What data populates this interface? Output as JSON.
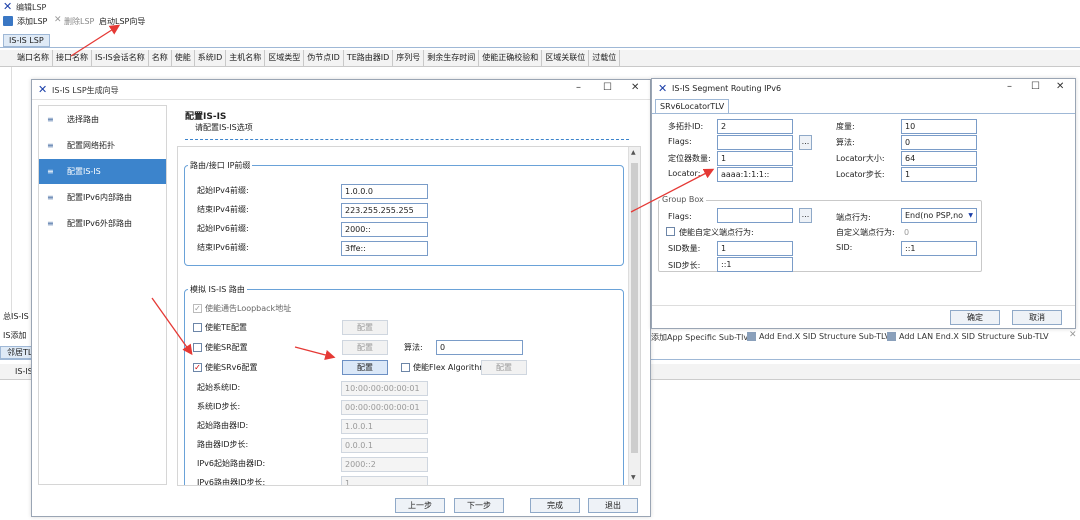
{
  "main": {
    "title": "编辑LSP",
    "toolbar": {
      "add": "添加LSP",
      "delete": "删除LSP",
      "wizard": "启动LSP向导"
    },
    "tab": "IS-IS LSP",
    "columns": [
      "端口名称",
      "接口名称",
      "IS-IS会话名称",
      "名称",
      "使能",
      "系统ID",
      "主机名称",
      "区域类型",
      "伪节点ID",
      "TE路由器ID",
      "序列号",
      "剩余生存时间",
      "使能正确校验和",
      "区域关联位",
      "过载位"
    ],
    "bottom_label1": "总IS-IS L",
    "bottom_label2": "IS添加",
    "bottom_tab": "邻居TL",
    "bottom_col": "IS-IS",
    "subtlv_bar": {
      "a": "添加App Specific Sub-Tlv",
      "b": "Add End.X SID Structure Sub-TLV",
      "c": "Add LAN End.X SID Structure Sub-TLV"
    }
  },
  "wizard": {
    "title": "IS-IS LSP生成向导",
    "nav": [
      "选择路由",
      "配置网络拓扑",
      "配置IS-IS",
      "配置IPv6内部路由",
      "配置IPv6外部路由"
    ],
    "heading": "配置IS-IS",
    "subheading": "请配置IS-IS选项",
    "group1": {
      "title": "路由/接口 IP前缀",
      "rows": [
        {
          "label": "起始IPv4前缀:",
          "value": "1.0.0.0"
        },
        {
          "label": "结束IPv4前缀:",
          "value": "223.255.255.255"
        },
        {
          "label": "起始IPv6前缀:",
          "value": "2000::"
        },
        {
          "label": "结束IPv6前缀:",
          "value": "3ffe::"
        }
      ]
    },
    "group2": {
      "title": "模拟 IS-IS 路由",
      "loopback": "使能通告Loopback地址",
      "te": "使能TE配置",
      "sr": "使能SR配置",
      "algo_label": "算法:",
      "algo_value": "0",
      "srv6": "使能SRv6配置",
      "flexalgo": "使能Flex Algorithm",
      "config": "配置",
      "rows": [
        {
          "label": "起始系统ID:",
          "value": "10:00:00:00:00:01"
        },
        {
          "label": "系统ID步长:",
          "value": "00:00:00:00:00:01"
        },
        {
          "label": "起始路由器ID:",
          "value": "1.0.0.1"
        },
        {
          "label": "路由器ID步长:",
          "value": "0.0.0.1"
        },
        {
          "label": "IPv6起始路由器ID:",
          "value": "2000::2"
        },
        {
          "label": "IPv6路由器ID步长:",
          "value": "1"
        }
      ]
    },
    "buttons": {
      "prev": "上一步",
      "next": "下一步",
      "finish": "完成",
      "exit": "退出"
    }
  },
  "srv6": {
    "title": "IS-IS Segment Routing IPv6",
    "tab": "SRv6LocatorTLV",
    "fields": {
      "mtid_label": "多拓扑ID:",
      "mtid": "2",
      "metric_label": "度量:",
      "metric": "10",
      "flags_label": "Flags:",
      "flags": "",
      "algo_label": "算法:",
      "algo": "0",
      "locnum_label": "定位器数量:",
      "locnum": "1",
      "locsize_label": "Locator大小:",
      "locsize": "64",
      "loc_label": "Locator:",
      "loc": "aaaa:1:1:1::",
      "locstep_label": "Locator步长:",
      "locstep": "1"
    },
    "groupbox": {
      "title": "Group Box",
      "flags_label": "Flags:",
      "flags": "",
      "behavior_label": "端点行为:",
      "behavior": "End(no PSP,no",
      "custom_chk": "使能自定义端点行为:",
      "custom_label": "自定义端点行为:",
      "custom": "0",
      "sidnum_label": "SID数量:",
      "sidnum": "1",
      "sid_label": "SID:",
      "sid": "::1",
      "sidstep_label": "SID步长:",
      "sidstep": "::1"
    },
    "ok": "确定",
    "cancel": "取消",
    "ellipsis": "..."
  },
  "colors": {
    "accent": "#3c84cc",
    "arrow": "#e53935"
  }
}
